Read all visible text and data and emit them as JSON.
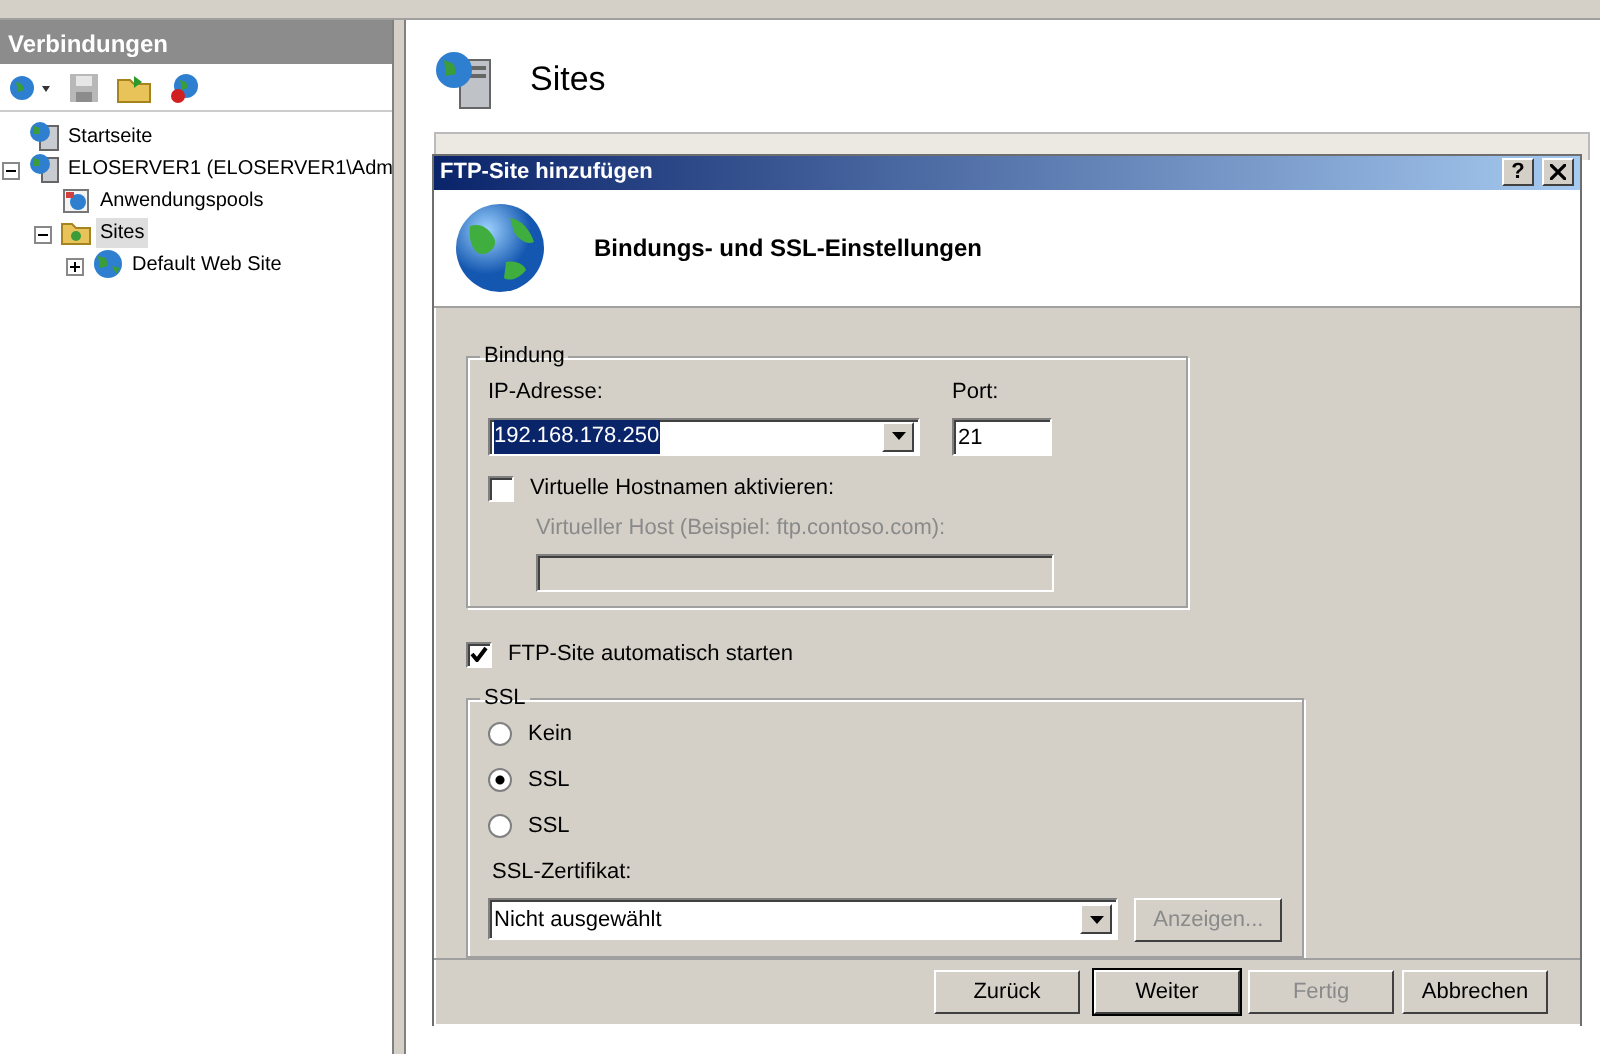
{
  "sidebar": {
    "title": "Verbindungen",
    "tree": [
      {
        "label": "Startseite",
        "kind": "home",
        "selected": false
      },
      {
        "label": "ELOSERVER1 (ELOSERVER1\\Adm",
        "kind": "server",
        "expanded": true,
        "selected": false,
        "children": [
          {
            "label": "Anwendungspools",
            "kind": "pools",
            "selected": false
          },
          {
            "label": "Sites",
            "kind": "folder",
            "expanded": true,
            "selected": true,
            "children": [
              {
                "label": "Default Web Site",
                "kind": "site",
                "expanded": false,
                "selected": false,
                "has_children": true
              }
            ]
          }
        ]
      }
    ]
  },
  "content": {
    "title": "Sites"
  },
  "dialog": {
    "title": "FTP-Site hinzufügen",
    "help": "?",
    "heading": "Bindungs- und SSL-Einstellungen",
    "binding": {
      "legend": "Bindung",
      "ip_label": "IP-Adresse:",
      "ip_value": "192.168.178.250",
      "port_label": "Port:",
      "port_value": "21",
      "virtual_hosts": {
        "label": "Virtuelle Hostnamen aktivieren:",
        "checked": false
      },
      "host_field": {
        "label": "Virtueller Host (Beispiel: ftp.contoso.com):",
        "disabled": true
      }
    },
    "autostart": {
      "label": "FTP-Site automatisch starten",
      "checked": true
    },
    "ssl": {
      "legend": "SSL",
      "options": [
        {
          "label": "Kein",
          "selected": false
        },
        {
          "label": "SSL",
          "selected": true
        },
        {
          "label": "SSL",
          "selected": false
        }
      ],
      "certificate_label": "SSL-Zertifikat:",
      "certificate_value": "Nicht ausgewählt",
      "view_button": {
        "label": "Anzeigen...",
        "disabled": true
      }
    },
    "buttons": [
      {
        "label": "Zurück",
        "disabled": false,
        "default": false
      },
      {
        "label": "Weiter",
        "disabled": false,
        "default": true
      },
      {
        "label": "Fertig",
        "disabled": true,
        "default": false
      },
      {
        "label": "Abbrechen",
        "disabled": false,
        "default": false
      }
    ]
  }
}
